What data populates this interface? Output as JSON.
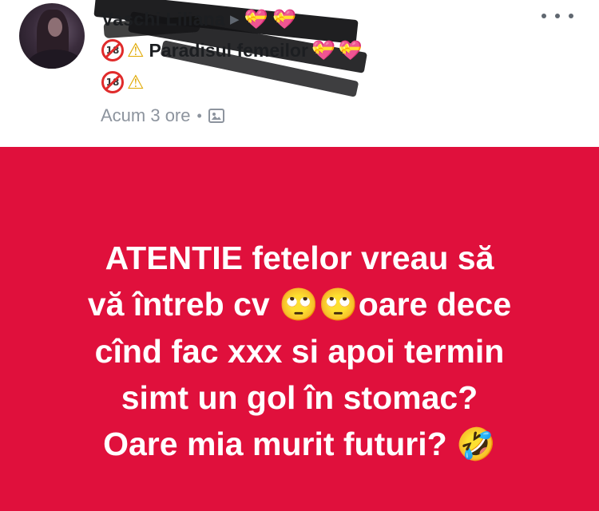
{
  "header": {
    "author_name": "Vaschi Liliana",
    "arrow": "▶",
    "author_emojis": [
      "💝",
      "💝"
    ],
    "group_name": "Paradisul femeilor",
    "group_badge": "18",
    "group_emojis": [
      "💝",
      "💝"
    ],
    "timestamp": "Acum 3 ore",
    "separator": "•",
    "privacy_icon": "photo-icon",
    "more_icon": "more-dots-icon"
  },
  "post": {
    "background_color": "#e0103c",
    "text_color": "#ffffff",
    "lines": [
      "ATENTIE  fetelor vreau să",
      "vă întreb cv ",
      "oare dece",
      "cînd fac xxx si apoi termin",
      "simt un gol în stomac?",
      "Oare mia murit futuri? "
    ],
    "emojis": {
      "eye_roll": "🙄",
      "laugh": "🤣"
    }
  }
}
